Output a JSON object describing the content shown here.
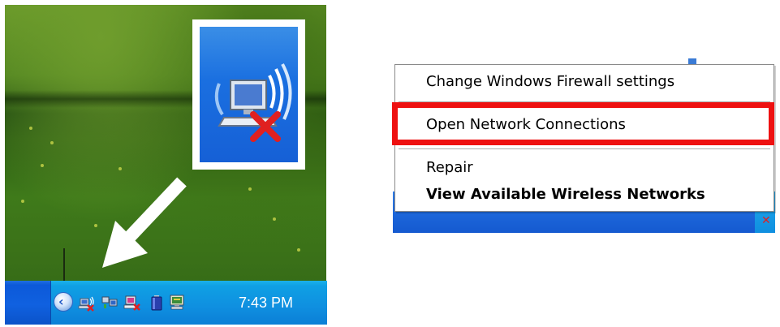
{
  "left_panel": {
    "clock": "7:43 PM",
    "tray_chevron": "‹",
    "tray_icons": [
      "wireless-disconnected-icon",
      "network-icon",
      "network-adapter-error-icon",
      "battery-icon",
      "monitor-icon"
    ],
    "enlarged_icon": "wireless-network-disconnected-icon",
    "arrow": "white-pointer-arrow"
  },
  "context_menu": {
    "items": [
      {
        "label": "Change Windows Firewall settings",
        "bold": false
      },
      {
        "label": "Open Network Connections",
        "bold": false,
        "highlighted": true
      },
      {
        "label": "Repair",
        "bold": false
      },
      {
        "label": "View Available Wireless Networks",
        "bold": true
      }
    ]
  },
  "colors": {
    "highlight_border": "#ee1111",
    "taskbar_blue": "#1061e0",
    "tray_blue": "#0f8fe0",
    "error_x_red": "#e02020"
  }
}
